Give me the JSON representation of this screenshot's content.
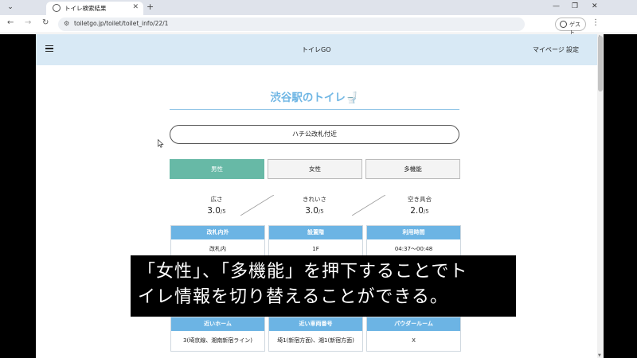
{
  "browser": {
    "tab_title": "トイレ検索結果",
    "url": "toiletgo.jp/toilet/toilet_info/22/1",
    "guest_label": "ゲスト"
  },
  "app": {
    "brand": "トイレGO",
    "nav": {
      "mypage": "マイページ",
      "settings": "設定"
    }
  },
  "toilet": {
    "title": "渋谷駅のトイレ🚽",
    "location": "ハチ公改札付近",
    "gender_tabs": [
      {
        "label": "男性",
        "active": true
      },
      {
        "label": "女性",
        "active": false
      },
      {
        "label": "多機能",
        "active": false
      }
    ],
    "ratings": [
      {
        "label": "広さ",
        "value": "3.0",
        "unit": "/5"
      },
      {
        "label": "きれいさ",
        "value": "3.0",
        "unit": "/5"
      },
      {
        "label": "空き具合",
        "value": "2.0",
        "unit": "/5"
      }
    ],
    "info_row1": [
      {
        "head": "改札内外",
        "body": "改札内"
      },
      {
        "head": "設置階",
        "body": "1F"
      },
      {
        "head": "利用時間",
        "body": "04:37〜00:48"
      }
    ],
    "info_row2": [
      {
        "head": "近いホーム",
        "body": "3(埼京線、湘南新宿ライン)"
      },
      {
        "head": "近い車両番号",
        "body": "埼1(新宿方面)、湘1(新宿方面)"
      },
      {
        "head": "パウダールーム",
        "body": "X"
      }
    ]
  },
  "caption": {
    "line1": "「女性」、「多機能」を押下することでト",
    "line2": "イレ情報を切り替えることができる。"
  },
  "colors": {
    "accent_blue": "#6cb4e4",
    "active_tab": "#67b9a6",
    "appbar": "#d8e9f5"
  }
}
